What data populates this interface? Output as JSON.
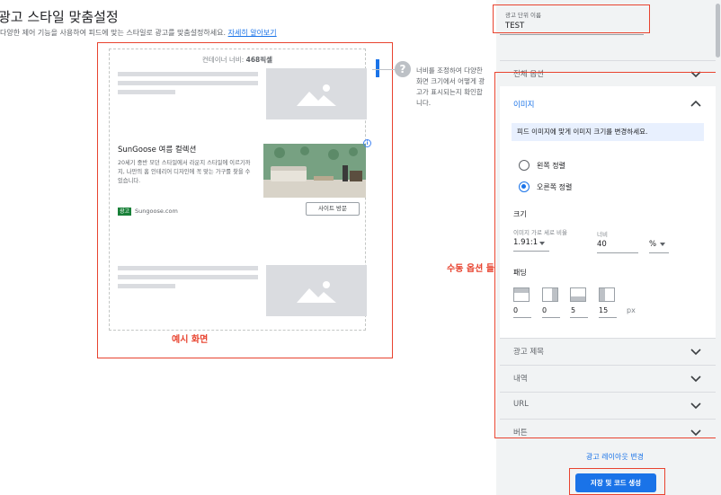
{
  "page": {
    "title": "광고 스타일 맞춤설정",
    "subtitle": "다양한 제어 기능을 사용하여 피드에 맞는 스타일로 광고를 맞춤설정하세요.",
    "learn_more": "자세히 알아보기"
  },
  "preview": {
    "container_width_label": "컨테이너 너비:",
    "container_width_value": "468픽셀",
    "example_label": "예시 화면",
    "help_text": "너비를 조정하여 다양한 화면 크기에서 어떻게 광고가 표시되는지 확인합니다."
  },
  "ad": {
    "title": "SunGoose 여름 컬렉션",
    "description": "20세기 중반 모던 스타일에서 라운지 스타일에 이르기까지, 나만의 홈 인테리어 디자인에 꼭 맞는 가구를 찾을 수 있습니다.",
    "badge": "광고",
    "domain": "Sungoose.com",
    "cta": "사이트 방문",
    "info_icon": "i"
  },
  "annotations": {
    "manual_options": "수동 옵션 들"
  },
  "panel": {
    "ad_unit_name_label": "광고 단위 이름",
    "ad_unit_name_value": "TEST",
    "global_options": "전체 옵션",
    "image_section": {
      "title": "이미지",
      "info": "피드 이미지에 맞게 이미지 크기를 변경하세요.",
      "align_left": "왼쪽 정렬",
      "align_right": "오른쪽 정렬",
      "selected_alignment": "align_right",
      "size_label": "크기",
      "aspect_ratio_label": "이미지 가로 세로 비율",
      "aspect_ratio_value": "1.91:1",
      "width_label": "너비",
      "width_value": "40",
      "width_unit": "%",
      "padding_label": "패딩",
      "padding_top": "0",
      "padding_left": "0",
      "padding_bottom": "5",
      "padding_right": "15",
      "padding_unit": "px"
    },
    "ad_title": "광고 제목",
    "description": "내역",
    "url": "URL",
    "button": "버튼",
    "change_layout": "광고 레이아웃 변경",
    "save_button": "저장 및 코드 생성"
  },
  "colors": {
    "accent": "#1a73e8",
    "annotation_red": "#e8432f",
    "panel_bg": "#f1f3f4",
    "info_bg": "#e8f0fe"
  },
  "icons": [
    "help-icon",
    "chevron-down-icon",
    "chevron-up-icon",
    "image-placeholder-icon",
    "info-icon",
    "padding-top-icon",
    "padding-left-icon",
    "padding-bottom-icon",
    "padding-right-icon"
  ]
}
